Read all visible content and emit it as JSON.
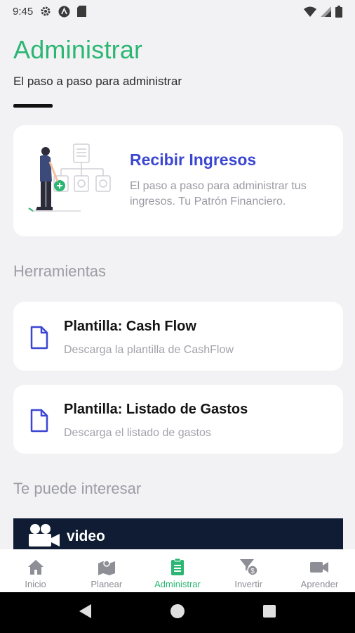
{
  "status_bar": {
    "time": "9:45",
    "icons": [
      "gear-icon",
      "a-badge-icon",
      "sd-card-icon",
      "wifi-icon",
      "signal-icon",
      "battery-icon"
    ]
  },
  "header": {
    "title": "Administrar",
    "subtitle": "El paso a paso para administrar"
  },
  "hero": {
    "title": "Recibir Ingresos",
    "description": "El paso a paso para administrar tus ingresos. Tu Patrón Financiero."
  },
  "tools": {
    "heading": "Herramientas",
    "items": [
      {
        "title": "Plantilla: Cash Flow",
        "description": "Descarga la plantilla de CashFlow",
        "icon": "document-icon"
      },
      {
        "title": "Plantilla: Listado de Gastos",
        "description": "Descarga el listado de gastos",
        "icon": "document-icon"
      }
    ]
  },
  "interest": {
    "heading": "Te puede interesar",
    "video_label": "video"
  },
  "bottom_nav": {
    "items": [
      {
        "label": "Inicio",
        "icon": "home-icon"
      },
      {
        "label": "Planear",
        "icon": "map-icon"
      },
      {
        "label": "Administrar",
        "icon": "clipboard-icon",
        "active": true
      },
      {
        "label": "Invertir",
        "icon": "funnel-dollar-icon"
      },
      {
        "label": "Aprender",
        "icon": "video-camera-icon"
      }
    ]
  },
  "colors": {
    "accent_green": "#2bb673",
    "hero_blue": "#3b46d2",
    "doc_icon_blue": "#3b46d2",
    "video_banner": "#0f1c33"
  }
}
